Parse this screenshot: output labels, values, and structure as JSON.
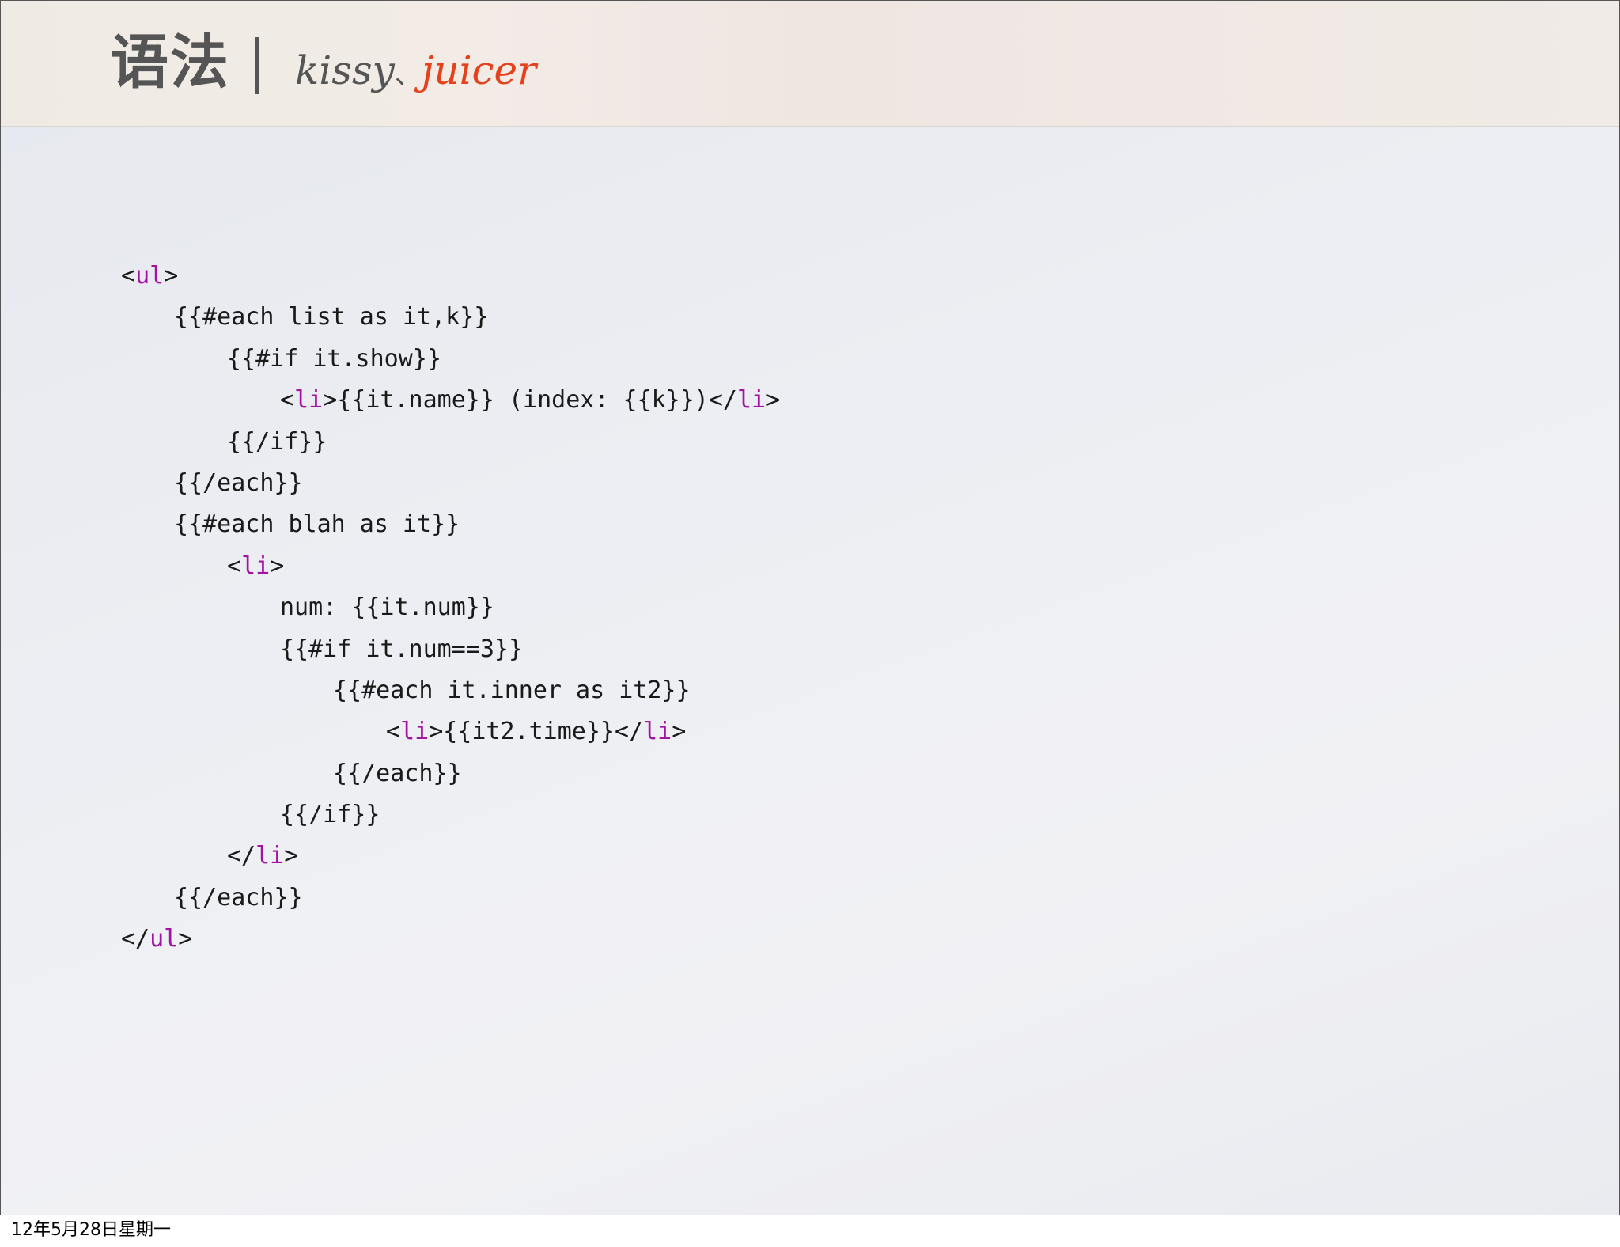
{
  "header": {
    "title": "语法",
    "subtitle_kissy": "kissy",
    "subtitle_separator": "、",
    "subtitle_juicer": "juicer",
    "colors": {
      "title": "#555555",
      "juicer": "#e4421c",
      "tag": "#a313a3"
    }
  },
  "code": {
    "lines": [
      {
        "indent": 0,
        "parts": [
          {
            "t": "<"
          },
          {
            "t": "ul",
            "tag": true
          },
          {
            "t": ">"
          }
        ]
      },
      {
        "indent": 1,
        "parts": [
          {
            "t": "{{#each list as it,k}}"
          }
        ]
      },
      {
        "indent": 2,
        "parts": [
          {
            "t": "{{#if it.show}}"
          }
        ]
      },
      {
        "indent": 3,
        "parts": [
          {
            "t": "<"
          },
          {
            "t": "li",
            "tag": true
          },
          {
            "t": ">{{it.name}} (index: {{k}})</"
          },
          {
            "t": "li",
            "tag": true
          },
          {
            "t": ">"
          }
        ]
      },
      {
        "indent": 2,
        "parts": [
          {
            "t": "{{/if}}"
          }
        ]
      },
      {
        "indent": 1,
        "parts": [
          {
            "t": "{{/each}}"
          }
        ]
      },
      {
        "indent": 1,
        "parts": [
          {
            "t": "{{#each blah as it}}"
          }
        ]
      },
      {
        "indent": 2,
        "parts": [
          {
            "t": "<"
          },
          {
            "t": "li",
            "tag": true
          },
          {
            "t": ">"
          }
        ]
      },
      {
        "indent": 3,
        "parts": [
          {
            "t": "num: {{it.num}}"
          }
        ]
      },
      {
        "indent": 3,
        "parts": [
          {
            "t": "{{#if it.num==3}}"
          }
        ]
      },
      {
        "indent": 4,
        "parts": [
          {
            "t": "{{#each it.inner as it2}}"
          }
        ]
      },
      {
        "indent": 5,
        "parts": [
          {
            "t": "<"
          },
          {
            "t": "li",
            "tag": true
          },
          {
            "t": ">{{it2.time}}</"
          },
          {
            "t": "li",
            "tag": true
          },
          {
            "t": ">"
          }
        ]
      },
      {
        "indent": 4,
        "parts": [
          {
            "t": "{{/each}}"
          }
        ]
      },
      {
        "indent": 3,
        "parts": [
          {
            "t": "{{/if}}"
          }
        ]
      },
      {
        "indent": 2,
        "parts": [
          {
            "t": "</"
          },
          {
            "t": "li",
            "tag": true
          },
          {
            "t": ">"
          }
        ]
      },
      {
        "indent": 1,
        "parts": [
          {
            "t": "{{/each}}"
          }
        ]
      },
      {
        "indent": 0,
        "parts": [
          {
            "t": "</"
          },
          {
            "t": "ul",
            "tag": true
          },
          {
            "t": ">"
          }
        ]
      }
    ]
  },
  "footer": {
    "date": "12年5月28日星期一"
  }
}
